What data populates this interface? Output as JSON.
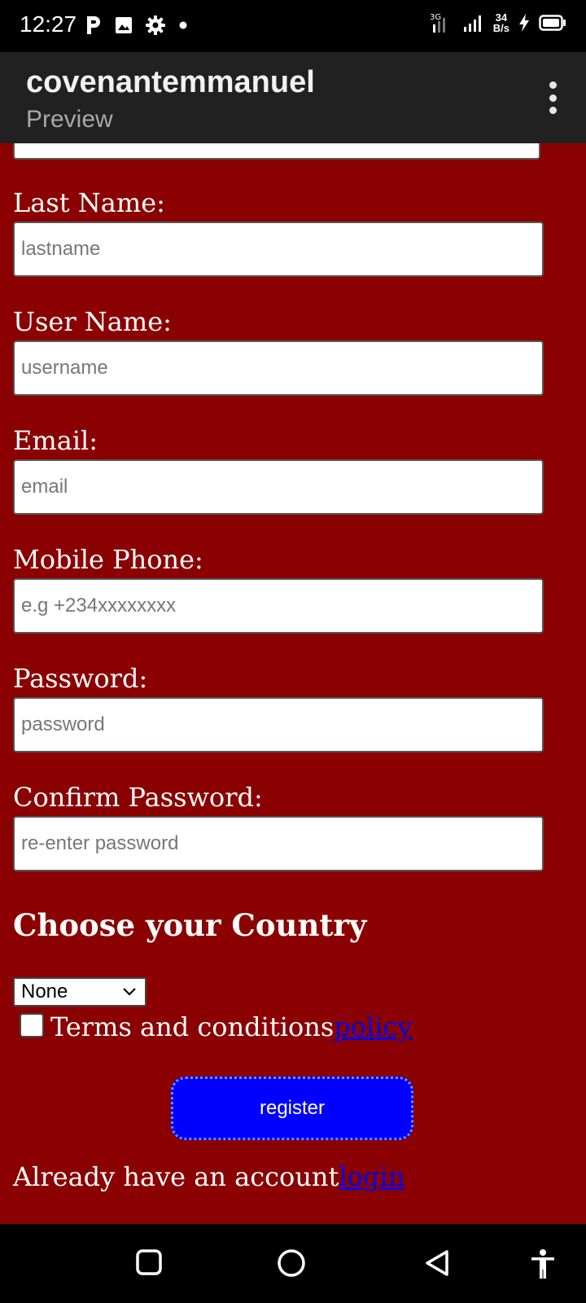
{
  "status_bar": {
    "time": "12:27",
    "network_speed_value": "34",
    "network_speed_unit": "B/s",
    "icons": [
      "parking-app-icon",
      "image-icon",
      "settings-gear-icon",
      "notification-dot-icon",
      "signal-icon",
      "charging-icon",
      "battery-icon"
    ]
  },
  "app_bar": {
    "title": "covenantemmanuel",
    "subtitle": "Preview",
    "menu_icon": "more-vert-icon"
  },
  "form": {
    "lastname": {
      "label": "Last Name:",
      "placeholder": "lastname"
    },
    "username": {
      "label": "User Name:",
      "placeholder": "username"
    },
    "email": {
      "label": "Email:",
      "placeholder": "email"
    },
    "phone": {
      "label": "Mobile Phone:",
      "placeholder": "e.g +234xxxxxxxx"
    },
    "password": {
      "label": "Password:",
      "placeholder": "password"
    },
    "confirm_password": {
      "label": "Confirm Password:",
      "placeholder": "re-enter password"
    },
    "country_heading": "Choose your Country",
    "country_selected": "None",
    "terms_text": "Terms and conditions",
    "terms_link": "policy",
    "register_label": "register",
    "account_text": "Already have an account",
    "login_link": "login"
  },
  "colors": {
    "form_background": "#8b0000",
    "register_button": "#0000ff",
    "link": "#0000ee",
    "app_bar": "#212121"
  },
  "nav_bar": {
    "icons": [
      "recents-square-icon",
      "home-circle-icon",
      "back-triangle-icon",
      "accessibility-icon"
    ]
  }
}
